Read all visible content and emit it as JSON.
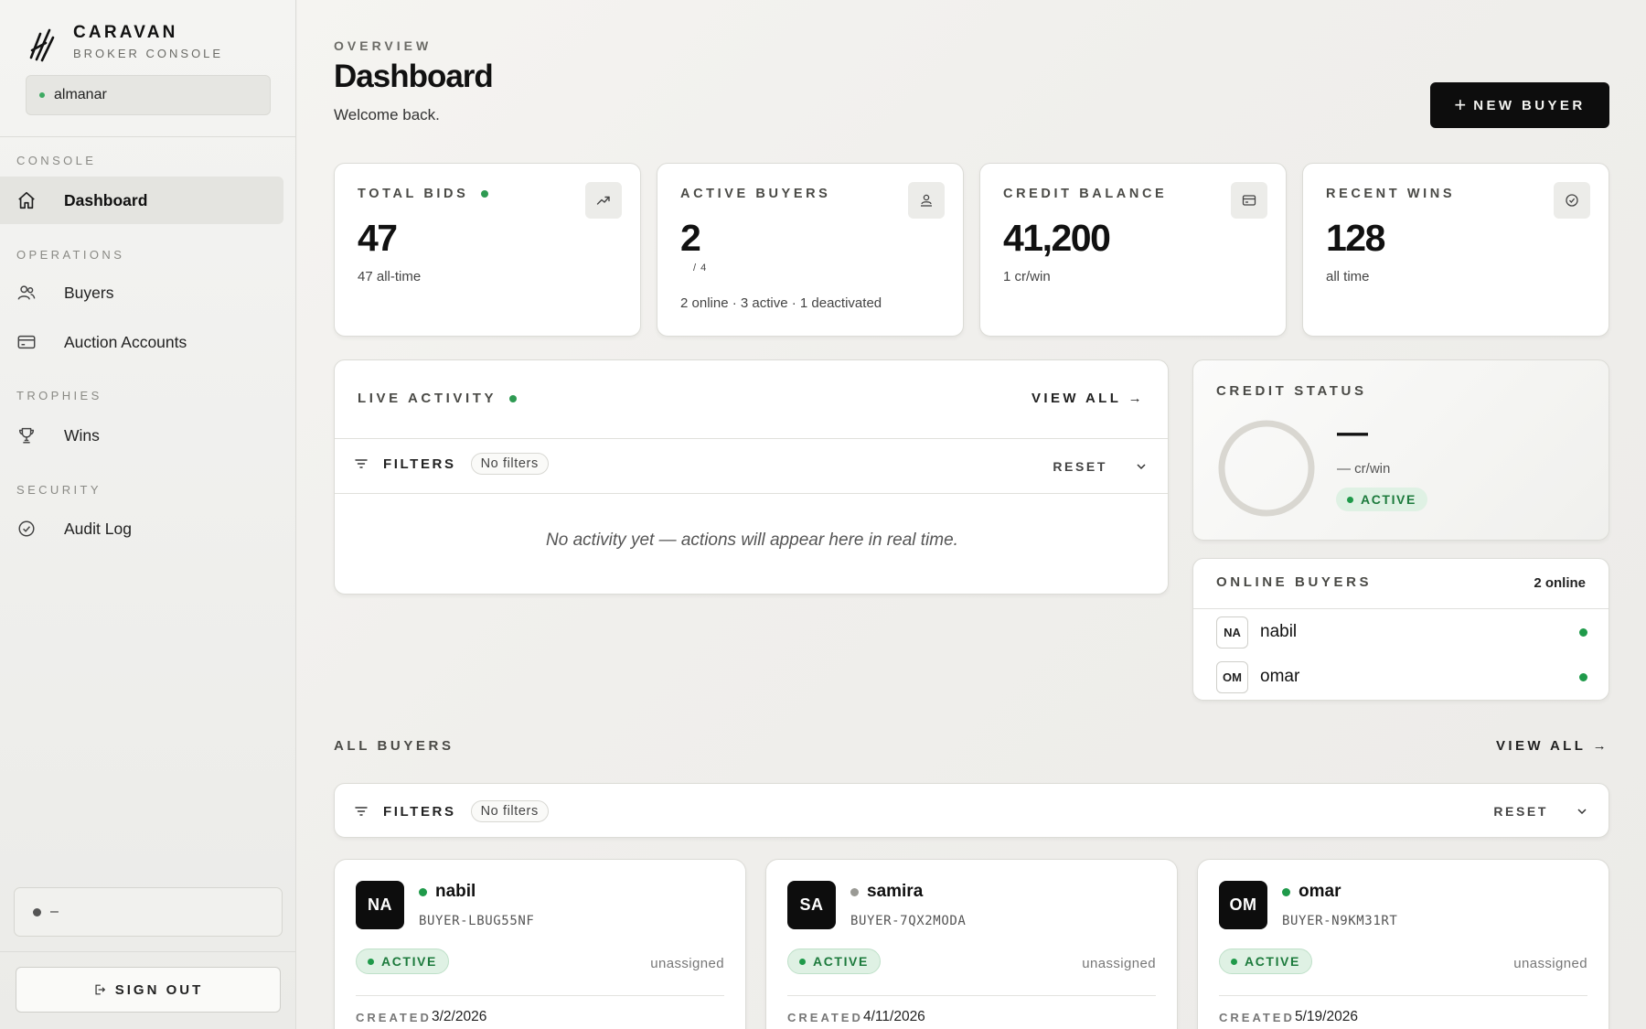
{
  "brand": {
    "name": "CARAVAN",
    "subtitle": "BROKER CONSOLE"
  },
  "user": {
    "name": "almanar",
    "status_color": "#3eaa62"
  },
  "sidebar": {
    "sections": [
      {
        "title": "CONSOLE",
        "items": [
          {
            "label": "Dashboard",
            "icon": "home-icon",
            "active": true
          }
        ]
      },
      {
        "title": "OPERATIONS",
        "items": [
          {
            "label": "Buyers",
            "icon": "users-icon"
          },
          {
            "label": "Auction Accounts",
            "icon": "card-icon"
          }
        ]
      },
      {
        "title": "TROPHIES",
        "items": [
          {
            "label": "Wins",
            "icon": "trophy-icon"
          }
        ]
      },
      {
        "title": "SECURITY",
        "items": [
          {
            "label": "Audit Log",
            "icon": "check-circle-icon"
          }
        ]
      }
    ],
    "status_text": "–",
    "sign_out_label": "SIGN OUT"
  },
  "header": {
    "eyebrow": "OVERVIEW",
    "title": "Dashboard",
    "welcome": "Welcome back.",
    "new_buyer_label": "NEW BUYER"
  },
  "stats": [
    {
      "label": "TOTAL BIDS",
      "value": "47",
      "sub": "47 all-time",
      "icon": "trend-up-icon",
      "live": true
    },
    {
      "label": "ACTIVE BUYERS",
      "value": "2",
      "of": "/ 4",
      "sub": "2 online · 3 active · 1 deactivated",
      "icon": "user-badge-icon"
    },
    {
      "label": "CREDIT BALANCE",
      "value": "41,200",
      "sub": "1 cr/win",
      "icon": "wallet-icon"
    },
    {
      "label": "RECENT WINS",
      "value": "128",
      "sub": "all time",
      "icon": "check-circle-icon"
    }
  ],
  "activity": {
    "title": "LIVE ACTIVITY",
    "view_all": "VIEW ALL →",
    "filters_label": "FILTERS",
    "filters_chip": "No filters",
    "reset_label": "RESET",
    "empty_message": "No activity yet — actions will appear here in real time."
  },
  "credit_status": {
    "title": "CREDIT STATUS",
    "value": "—",
    "rate": "— cr/win",
    "badge": "ACTIVE"
  },
  "online_buyers": {
    "title": "ONLINE BUYERS",
    "count_label": "2 online",
    "items": [
      {
        "initials": "NA",
        "name": "nabil"
      },
      {
        "initials": "OM",
        "name": "omar"
      }
    ]
  },
  "all_buyers": {
    "title": "ALL BUYERS",
    "view_all": "VIEW ALL →",
    "filters_label": "FILTERS",
    "filters_chip": "No filters",
    "reset_label": "RESET",
    "created_label": "CREATED",
    "cards": [
      {
        "initials": "NA",
        "name": "nabil",
        "online": true,
        "id": "BUYER-LBUG55NF",
        "status": "ACTIVE",
        "assignment": "unassigned",
        "created": "3/2/2026"
      },
      {
        "initials": "SA",
        "name": "samira",
        "online": false,
        "id": "BUYER-7QX2MODA",
        "status": "ACTIVE",
        "assignment": "unassigned",
        "created": "4/11/2026"
      },
      {
        "initials": "OM",
        "name": "omar",
        "online": true,
        "id": "BUYER-N9KM31RT",
        "status": "ACTIVE",
        "assignment": "unassigned",
        "created": "5/19/2026"
      }
    ]
  },
  "colors": {
    "online": "#1f9a4a",
    "offline": "#9a9a95",
    "accent": "#0d0d0d",
    "active_badge_bg": "#dff1e4"
  }
}
